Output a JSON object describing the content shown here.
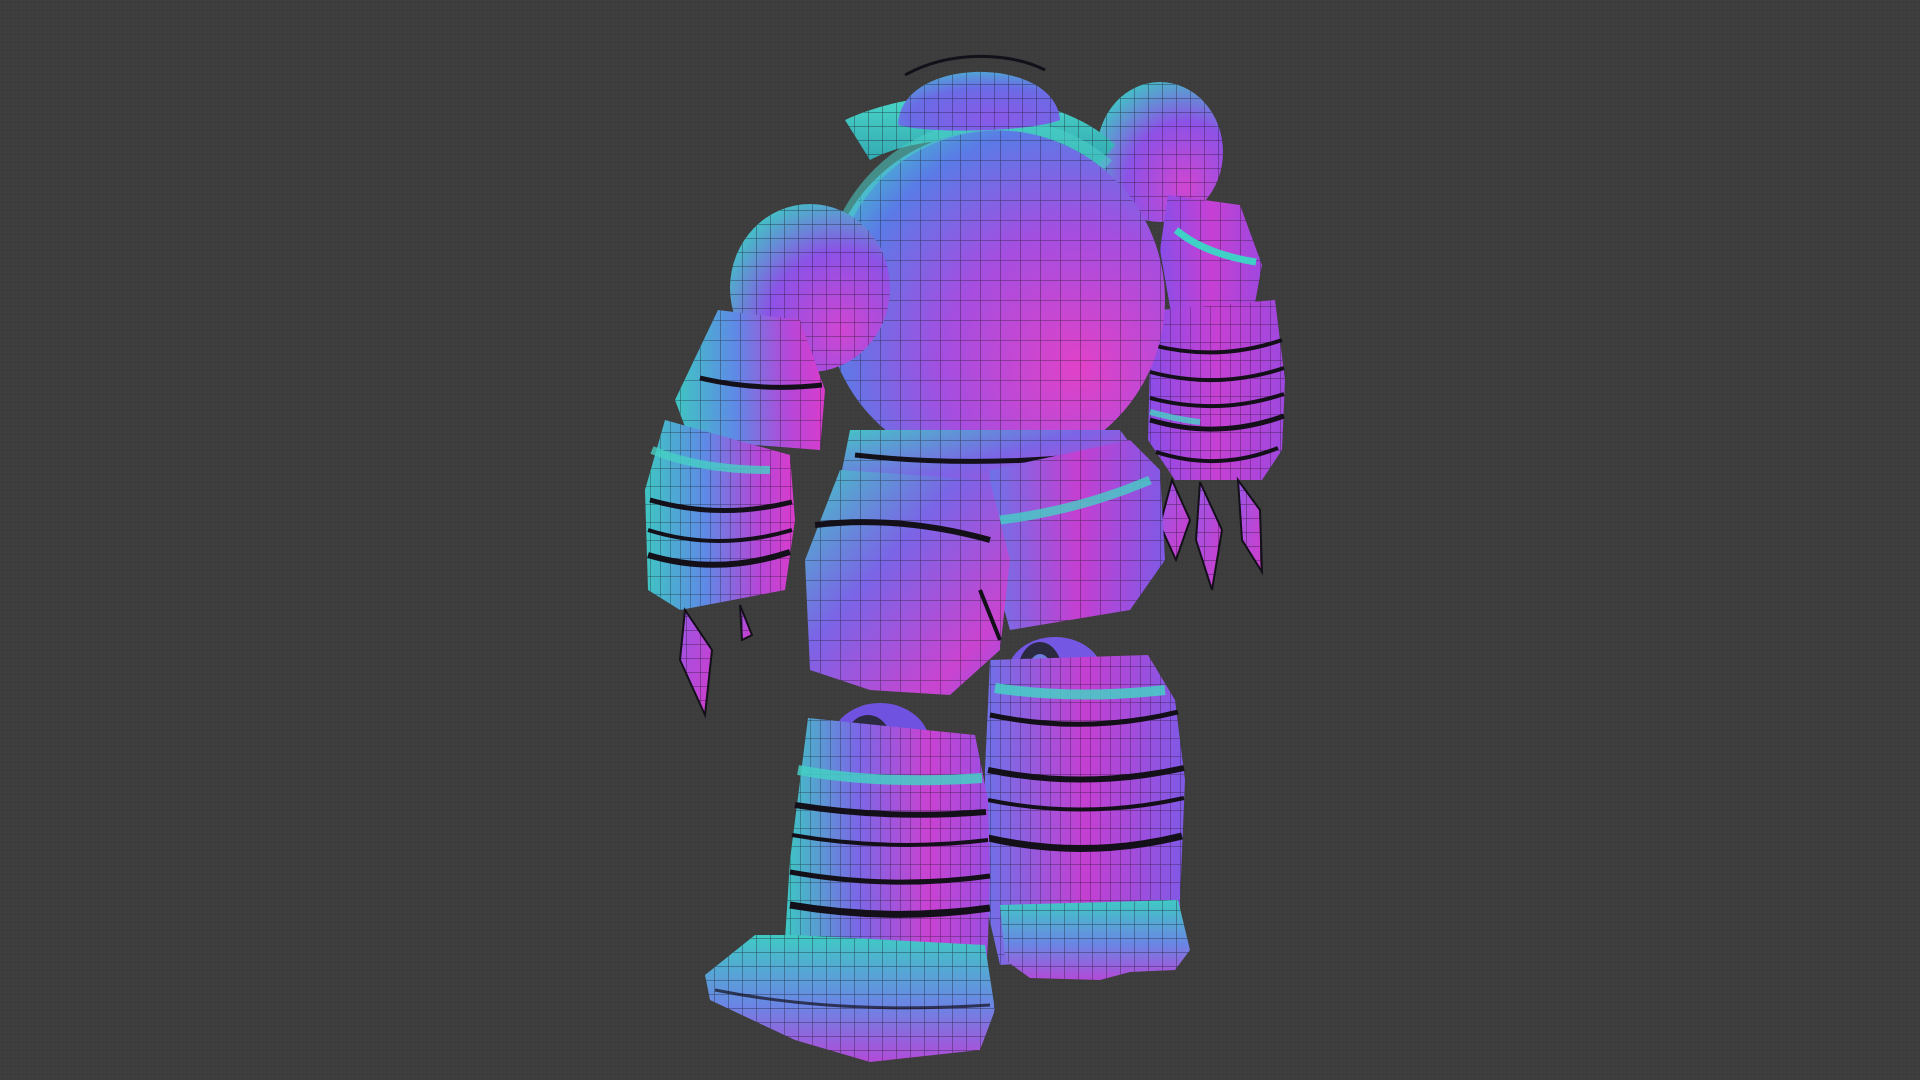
{
  "viewport": {
    "background_color": "#3d3d3d",
    "shading": "normal-map-wireframe",
    "subject": "robot-mesh"
  },
  "palette": {
    "magenta": "#c93ad0",
    "violet": "#7b4ff0",
    "teal": "#38c7c4",
    "wire": "#14101a"
  }
}
